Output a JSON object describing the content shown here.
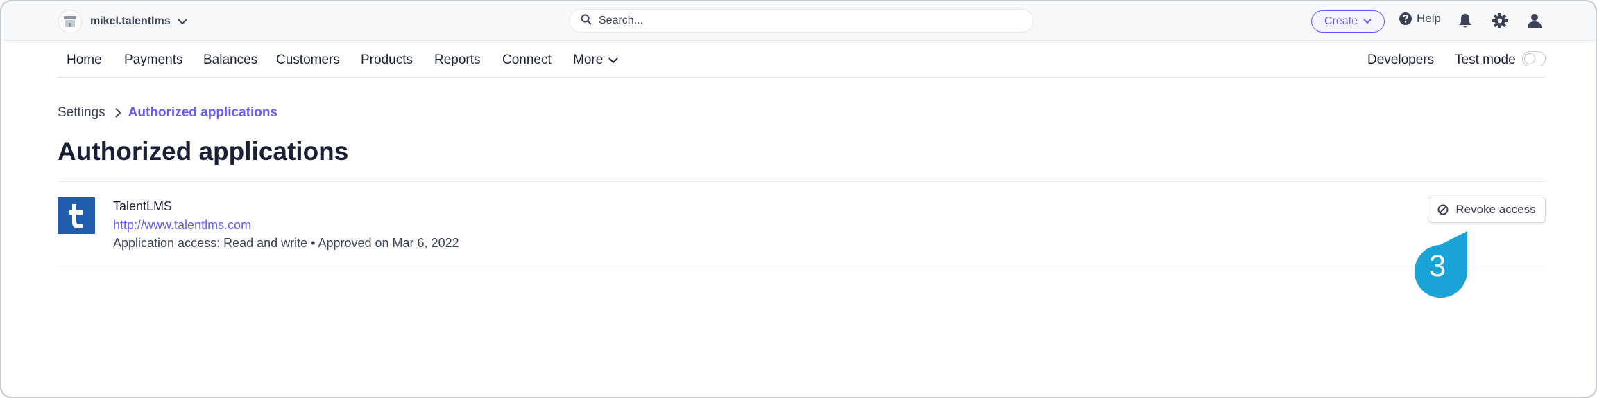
{
  "account": {
    "name": "mikel.talentlms"
  },
  "search": {
    "placeholder": "Search..."
  },
  "topbar": {
    "create_label": "Create",
    "help_label": "Help"
  },
  "nav": {
    "items": [
      "Home",
      "Payments",
      "Balances",
      "Customers",
      "Products",
      "Reports",
      "Connect",
      "More"
    ],
    "developers": "Developers",
    "test_mode": "Test mode",
    "test_mode_on": false
  },
  "breadcrumb": {
    "parent": "Settings",
    "current": "Authorized applications"
  },
  "page": {
    "title": "Authorized applications"
  },
  "application": {
    "logo_letter": "t",
    "name": "TalentLMS",
    "url": "http://www.talentlms.com",
    "access": "Application access: Read and write • Approved on Mar 6, 2022",
    "revoke_label": "Revoke access"
  },
  "step_marker": {
    "number": "3"
  },
  "colors": {
    "accent": "#635bff",
    "logo_bg": "#1f5dad",
    "marker": "#1aa3d6"
  }
}
